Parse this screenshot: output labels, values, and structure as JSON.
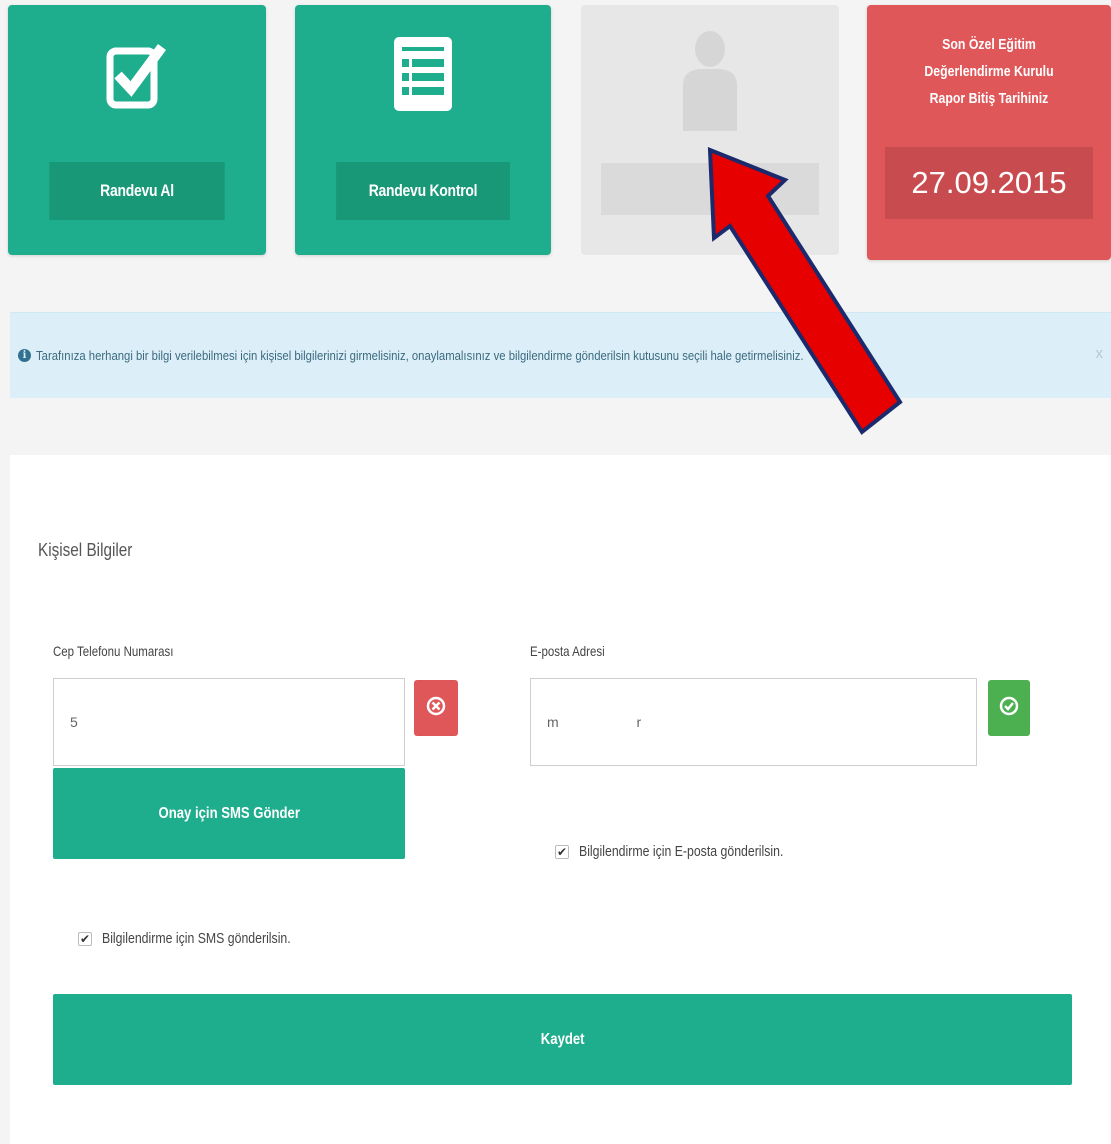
{
  "tiles": {
    "randevu_al": {
      "label": "Randevu Al",
      "icon": "checkbox-icon"
    },
    "randevu_kontrol": {
      "label": "Randevu Kontrol",
      "icon": "list-icon"
    },
    "profile": {
      "icon": "person-icon"
    },
    "report": {
      "title_line1": "Son Özel Eğitim",
      "title_line2": "Değerlendirme Kurulu",
      "title_line3": "Rapor Bitiş Tarihiniz",
      "date": "27.09.2015"
    }
  },
  "alert": {
    "icon": "info-icon",
    "text": "Tarafınıza herhangi bir bilgi verilebilmesi için kişisel bilgilerinizi girmelisiniz, onaylamalısınız ve bilgilendirme gönderilsin kutusunu seçili hale getirmelisiniz.",
    "close": "x"
  },
  "form": {
    "section_title": "Kişisel Bilgiler",
    "phone": {
      "label": "Cep Telefonu Numarası",
      "value": "5",
      "status_icon": "close-circle-icon"
    },
    "email": {
      "label": "E-posta Adresi",
      "value": "m                    r",
      "status_icon": "check-circle-icon"
    },
    "sms_button": "Onay için SMS Gönder",
    "email_checkbox": {
      "label": "Bilgilendirme için E-posta gönderilsin.",
      "checked": true
    },
    "sms_checkbox": {
      "label": "Bilgilendirme için SMS gönderilsin.",
      "checked": true
    },
    "save_button": "Kaydet"
  },
  "colors": {
    "green": "#1eae8d",
    "red": "#e0575a",
    "grey": "#e7e7e7",
    "alert_bg": "#dceff8",
    "annotation_arrow": "#e60000"
  }
}
